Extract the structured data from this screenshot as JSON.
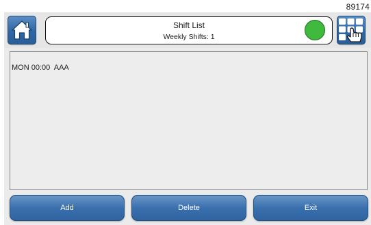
{
  "device_id": "89174",
  "header": {
    "title": "Shift List",
    "subtitle": "Weekly Shifts: 1",
    "status_color": "#3fba3f"
  },
  "icons": {
    "home": "home-icon",
    "menu": "keypad-hand-icon"
  },
  "shift_list": {
    "items": [
      {
        "label": "MON 00:00  AAA"
      }
    ]
  },
  "footer": {
    "add_label": "Add",
    "delete_label": "Delete",
    "exit_label": "Exit"
  },
  "colors": {
    "button_blue": "#3a6fad",
    "panel_gray": "#ededed"
  }
}
